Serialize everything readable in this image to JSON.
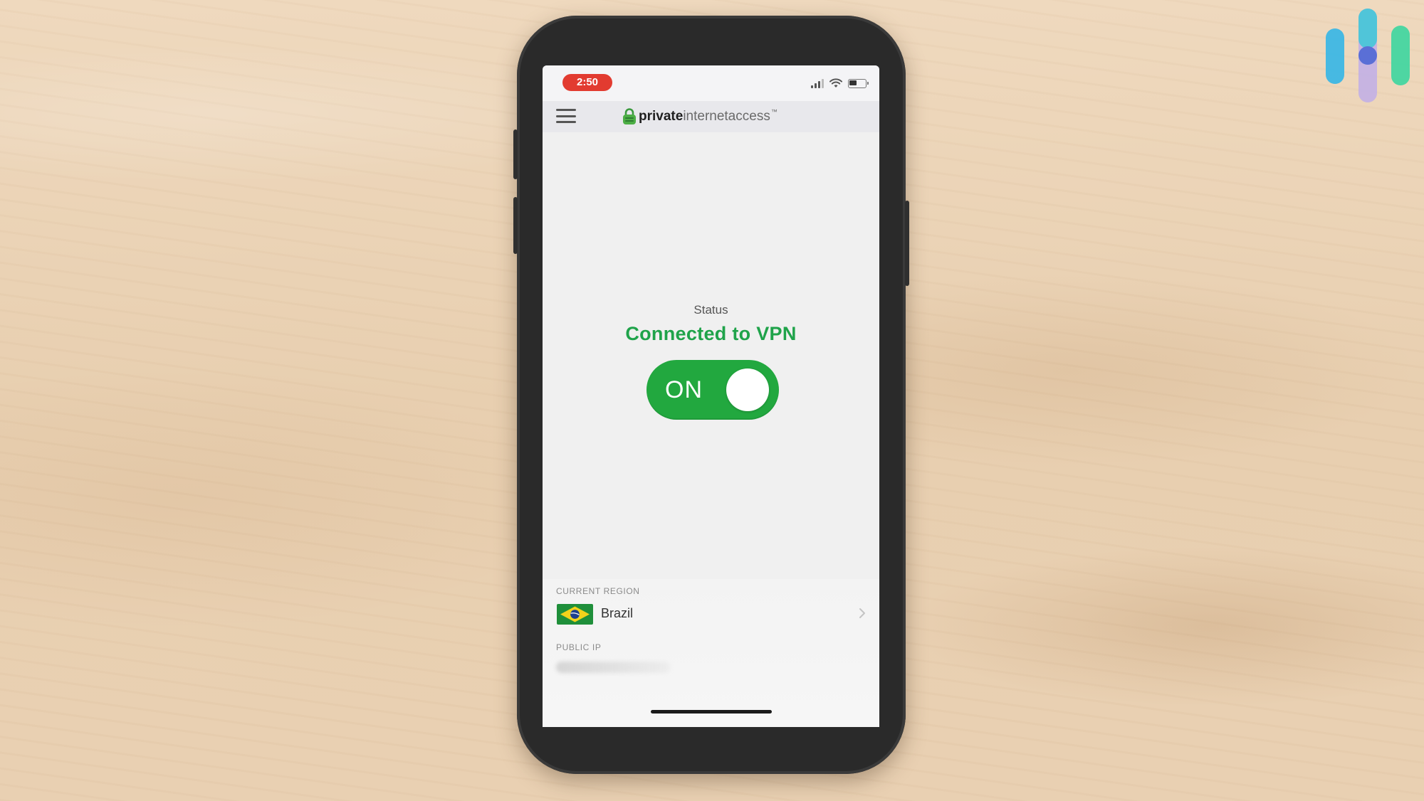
{
  "status_bar": {
    "time": "2:50"
  },
  "header": {
    "menu_icon": "hamburger-menu-icon",
    "logo": {
      "bold": "private",
      "light": "internetaccess",
      "tm": "™"
    }
  },
  "vpn": {
    "status_label": "Status",
    "status_text": "Connected to VPN",
    "toggle_label": "ON",
    "toggle_on": true
  },
  "region": {
    "label": "CURRENT REGION",
    "name": "Brazil",
    "flag_icon": "brazil-flag-icon"
  },
  "public_ip": {
    "label": "PUBLIC IP"
  },
  "colors": {
    "accent_green": "#22a83f",
    "status_green": "#1fa34a",
    "time_pill_red": "#e23b30"
  }
}
